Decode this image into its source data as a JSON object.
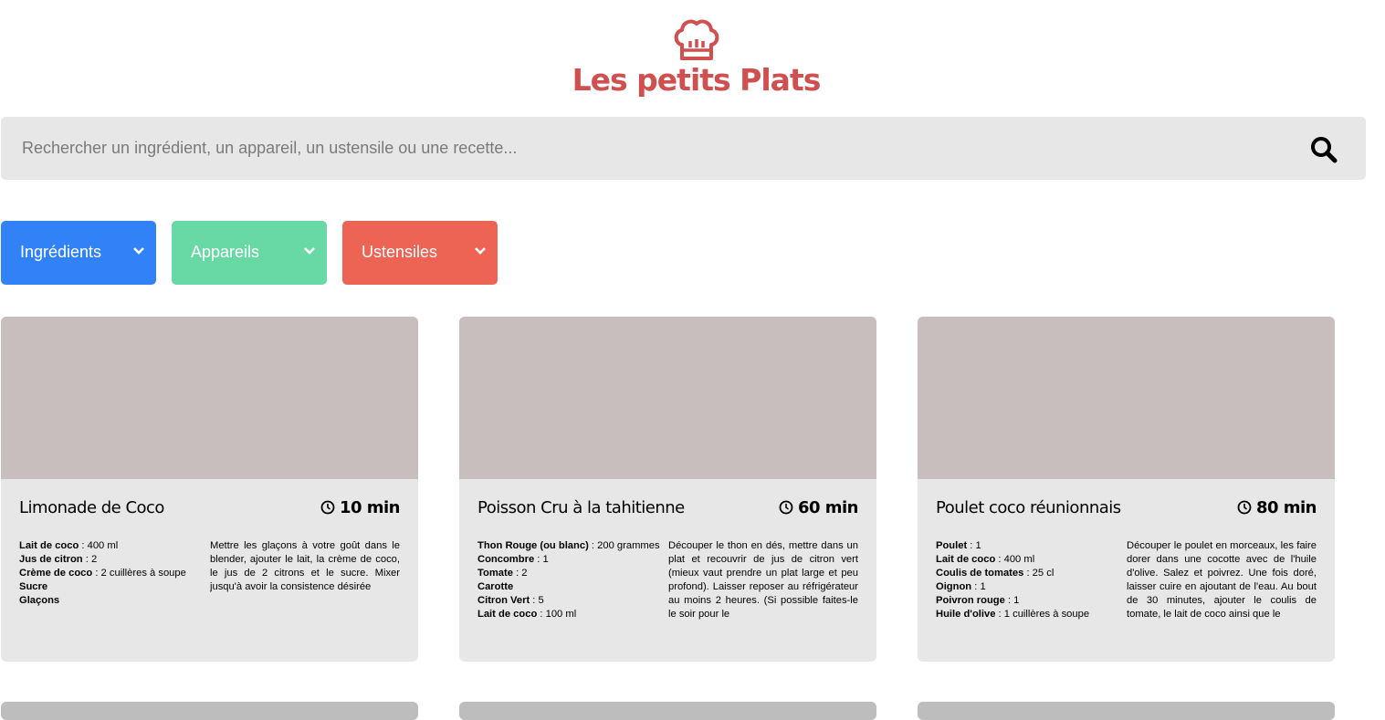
{
  "header": {
    "brand": "Les petits Plats",
    "logo_icon": "chef-hat-icon"
  },
  "search": {
    "placeholder": "Rechercher un ingrédient, un appareil, un ustensile ou une recette...",
    "value": "",
    "icon": "search-icon"
  },
  "filters": [
    {
      "label": "Ingrédients",
      "color": "#3282f7"
    },
    {
      "label": "Appareils",
      "color": "#68d9a4"
    },
    {
      "label": "Ustensiles",
      "color": "#ed6454"
    }
  ],
  "recipes": [
    {
      "title": "Limonade de Coco",
      "time": "10 min",
      "ingredients": [
        {
          "name": "Lait de coco",
          "qty": " : 400 ml"
        },
        {
          "name": "Jus de citron",
          "qty": " : 2"
        },
        {
          "name": "Crème de coco",
          "qty": " : 2 cuillères à soupe"
        },
        {
          "name": "Sucre",
          "qty": ""
        },
        {
          "name": "Glaçons",
          "qty": ""
        }
      ],
      "description": "Mettre les glaçons à votre goût dans le blender, ajouter le lait, la crème de coco, le jus de 2 citrons et le sucre. Mixer jusqu'à avoir la consistence désirée"
    },
    {
      "title": "Poisson Cru à la tahitienne",
      "time": "60 min",
      "ingredients": [
        {
          "name": "Thon Rouge (ou blanc)",
          "qty": " : 200 grammes"
        },
        {
          "name": "Concombre",
          "qty": " : 1"
        },
        {
          "name": "Tomate",
          "qty": " : 2"
        },
        {
          "name": "Carotte",
          "qty": ""
        },
        {
          "name": "Citron Vert",
          "qty": " : 5"
        },
        {
          "name": "Lait de coco",
          "qty": " : 100 ml"
        }
      ],
      "description": "Découper le thon en dés, mettre dans un plat et recouvrir de jus de citron vert (mieux vaut prendre un plat large et peu profond). Laisser reposer au réfrigérateur au moins 2 heures. (Si possible faites-le le soir pour le"
    },
    {
      "title": "Poulet coco réunionnais",
      "time": "80 min",
      "ingredients": [
        {
          "name": "Poulet",
          "qty": " : 1"
        },
        {
          "name": "Lait de coco",
          "qty": " : 400 ml"
        },
        {
          "name": "Coulis de tomates",
          "qty": " : 25 cl"
        },
        {
          "name": "Oignon",
          "qty": " : 1"
        },
        {
          "name": "Poivron rouge",
          "qty": " : 1"
        },
        {
          "name": "Huile d'olive",
          "qty": " : 1 cuillères à soupe"
        }
      ],
      "description": "Découper le poulet en morceaux, les faire dorer dans une cocotte avec de l'huile d'olive. Salez et poivrez. Une fois doré, laisser cuire en ajoutant de l'eau. Au bout de 30 minutes, ajouter le coulis de tomate, le lait de coco ainsi que le"
    }
  ]
}
